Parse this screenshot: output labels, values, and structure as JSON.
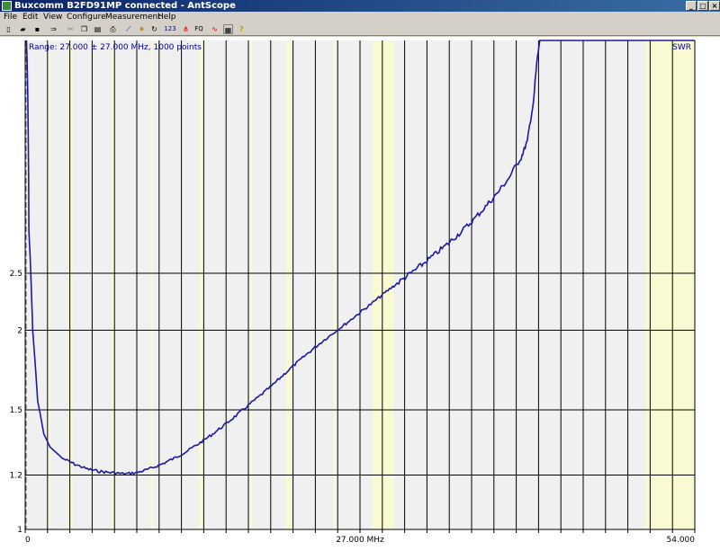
{
  "window": {
    "title": "Buxcomm B2FD91MP connected - AntScope",
    "min_glyph": "_",
    "max_glyph": "□",
    "close_glyph": "×"
  },
  "menu": {
    "items": [
      "File",
      "Edit",
      "View",
      "Configure",
      "Measurement",
      "Help"
    ]
  },
  "toolbar": {
    "buttons": [
      {
        "icon": "new-file-icon",
        "glyph": "▯"
      },
      {
        "icon": "open-folder-icon",
        "glyph": "▰"
      },
      {
        "icon": "save-icon",
        "glyph": "▪"
      },
      {
        "icon": "export-icon",
        "glyph": "⇒"
      },
      {
        "icon": "cut-icon",
        "glyph": "✂"
      },
      {
        "icon": "copy-icon",
        "glyph": "❐"
      },
      {
        "icon": "paste-icon",
        "glyph": "▤"
      },
      {
        "icon": "print-icon",
        "glyph": "⎙"
      },
      {
        "icon": "chart-icon",
        "glyph": "⟋"
      },
      {
        "icon": "settings-icon",
        "glyph": "✷"
      },
      {
        "icon": "refresh-icon",
        "glyph": "↻"
      },
      {
        "icon": "numbers-icon",
        "glyph": "123"
      },
      {
        "icon": "antenna-icon",
        "glyph": "⋔"
      },
      {
        "icon": "frequency-icon",
        "glyph": "FQ"
      },
      {
        "icon": "smith-chart-icon",
        "glyph": "∿"
      },
      {
        "icon": "table-icon",
        "glyph": "▦"
      },
      {
        "icon": "help-icon",
        "glyph": "?"
      }
    ]
  },
  "colors": {
    "trace": "#1a1aa6",
    "band_highlight": "#fafad2",
    "plot_bg": "#f0f0f0",
    "grid": "#000000",
    "label": "#0000a0"
  },
  "chart_data": {
    "type": "line",
    "range_label": "Range: 27.000 ± 27.000 MHz, 1000 points",
    "series_label": "SWR",
    "xlim": [
      0,
      54
    ],
    "ylim_swr": [
      1,
      10
    ],
    "y_scale": "reflection",
    "x_tick_labels": [
      {
        "value": 0,
        "label": "0"
      },
      {
        "value": 27,
        "label": "27.000 MHz"
      },
      {
        "value": 54,
        "label": "54.000"
      }
    ],
    "y_ticks": [
      {
        "value": 1.2,
        "label": "1.2"
      },
      {
        "value": 1.5,
        "label": "1.5"
      },
      {
        "value": 2,
        "label": "2"
      },
      {
        "value": 2.5,
        "label": "2.5"
      },
      {
        "value": 1,
        "label": "1"
      }
    ],
    "x_gridlines": [
      0,
      1.8,
      3.6,
      5.4,
      7.2,
      9.0,
      10.8,
      12.6,
      14.4,
      16.2,
      18.0,
      19.8,
      21.6,
      23.4,
      25.2,
      27.0,
      28.8,
      30.6,
      32.4,
      34.2,
      36.0,
      37.8,
      39.6,
      41.4,
      43.2,
      45.0,
      46.8,
      48.6,
      50.4,
      52.2,
      54.0
    ],
    "highlight_bands_mhz": [
      [
        1.8,
        2.0
      ],
      [
        3.5,
        3.8
      ],
      [
        7.0,
        7.2
      ],
      [
        10.1,
        10.15
      ],
      [
        14.0,
        14.35
      ],
      [
        18.068,
        18.168
      ],
      [
        21.0,
        21.45
      ],
      [
        24.89,
        24.99
      ],
      [
        28.0,
        29.7
      ],
      [
        50.0,
        54.0
      ]
    ],
    "grid": true,
    "series": [
      {
        "name": "SWR",
        "x": [
          0.1,
          0.3,
          0.6,
          1.0,
          1.5,
          2.0,
          3.0,
          4.0,
          5.0,
          6.0,
          7.0,
          8.0,
          9.0,
          10.0,
          11.0,
          12.0,
          13.0,
          14.0,
          15.0,
          16.0,
          17.0,
          18.0,
          19.0,
          20.0,
          21.0,
          22.0,
          23.0,
          24.0,
          25.0,
          26.0,
          27.0,
          28.0,
          29.0,
          30.0,
          31.0,
          32.0,
          33.0,
          34.0,
          35.0,
          36.0,
          37.0,
          38.0,
          39.0,
          40.0,
          40.5,
          41.0,
          41.5
        ],
        "y": [
          10.0,
          3.0,
          2.0,
          1.55,
          1.38,
          1.32,
          1.27,
          1.245,
          1.225,
          1.215,
          1.21,
          1.205,
          1.21,
          1.225,
          1.245,
          1.27,
          1.3,
          1.335,
          1.375,
          1.42,
          1.47,
          1.525,
          1.58,
          1.64,
          1.71,
          1.78,
          1.85,
          1.92,
          1.99,
          2.06,
          2.14,
          2.22,
          2.31,
          2.4,
          2.49,
          2.59,
          2.7,
          2.82,
          2.96,
          3.12,
          3.32,
          3.55,
          3.85,
          4.3,
          4.7,
          6.0,
          10.0
        ]
      }
    ]
  }
}
